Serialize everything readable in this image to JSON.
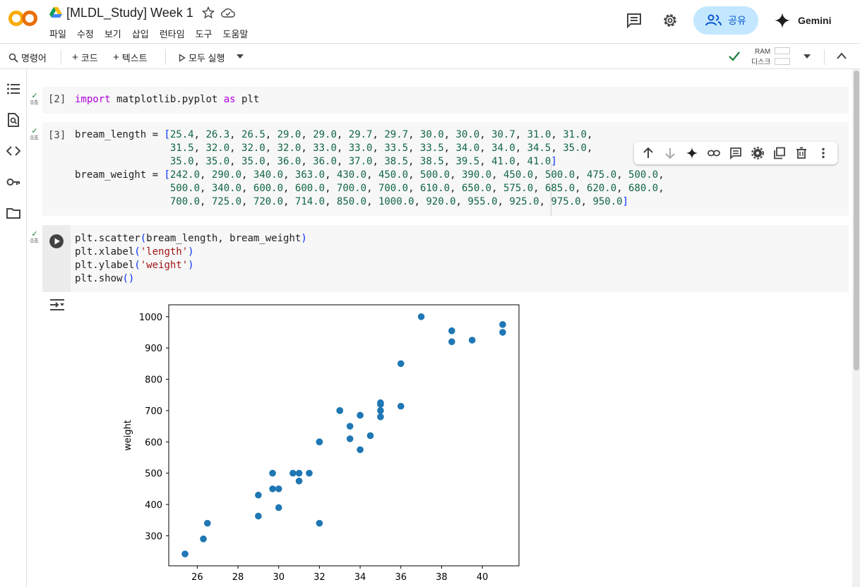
{
  "app": {
    "title": "[MLDL_Study] Week 1",
    "menu": [
      "파일",
      "수정",
      "보기",
      "삽입",
      "런타임",
      "도구",
      "도움말"
    ],
    "share_label": "공유",
    "gemini_label": "Gemini"
  },
  "toolbar": {
    "command_label": "명령어",
    "code_label": "코드",
    "text_label": "텍스트",
    "run_all_label": "모두 실행",
    "ram_label": "RAM",
    "disk_label": "디스크"
  },
  "cells": [
    {
      "count": "[2]",
      "time": "0초",
      "code": "import matplotlib.pyplot as plt"
    },
    {
      "count": "[3]",
      "time": "0초",
      "code": "bream_length = [25.4, 26.3, 26.5, 29.0, 29.0, 29.7, 29.7, 30.0, 30.0, 30.7, 31.0, 31.0,\n                31.5, 32.0, 32.0, 32.0, 33.0, 33.0, 33.5, 33.5, 34.0, 34.0, 34.5, 35.0,\n                35.0, 35.0, 35.0, 36.0, 36.0, 37.0, 38.5, 38.5, 39.5, 41.0, 41.0]\nbream_weight = [242.0, 290.0, 340.0, 363.0, 430.0, 450.0, 500.0, 390.0, 450.0, 500.0, 475.0, 500.0,\n                500.0, 340.0, 600.0, 600.0, 700.0, 700.0, 610.0, 650.0, 575.0, 685.0, 620.0, 680.0,\n                700.0, 725.0, 720.0, 714.0, 850.0, 1000.0, 920.0, 955.0, 925.0, 975.0, 950.0]"
    },
    {
      "count": "",
      "time": "0초",
      "code": "plt.scatter(bream_length, bream_weight)\nplt.xlabel('length')\nplt.ylabel('weight')\nplt.show()"
    }
  ],
  "chart_data": {
    "type": "scatter",
    "title": "",
    "xlabel": "",
    "ylabel": "weight",
    "xlim": [
      24.6,
      41.8
    ],
    "ylim": [
      204,
      1038
    ],
    "xticks": [
      26,
      28,
      30,
      32,
      34,
      36,
      38,
      40
    ],
    "yticks": [
      300,
      400,
      500,
      600,
      700,
      800,
      900,
      1000
    ],
    "color": "#1f77b4",
    "x": [
      25.4,
      26.3,
      26.5,
      29.0,
      29.0,
      29.7,
      29.7,
      30.0,
      30.0,
      30.7,
      31.0,
      31.0,
      31.5,
      32.0,
      32.0,
      32.0,
      33.0,
      33.0,
      33.5,
      33.5,
      34.0,
      34.0,
      34.5,
      35.0,
      35.0,
      35.0,
      35.0,
      36.0,
      36.0,
      37.0,
      38.5,
      38.5,
      39.5,
      41.0,
      41.0
    ],
    "y": [
      242.0,
      290.0,
      340.0,
      363.0,
      430.0,
      450.0,
      500.0,
      390.0,
      450.0,
      500.0,
      475.0,
      500.0,
      500.0,
      340.0,
      600.0,
      600.0,
      700.0,
      700.0,
      610.0,
      650.0,
      575.0,
      685.0,
      620.0,
      680.0,
      700.0,
      725.0,
      720.0,
      714.0,
      850.0,
      1000.0,
      920.0,
      955.0,
      925.0,
      975.0,
      950.0
    ]
  }
}
